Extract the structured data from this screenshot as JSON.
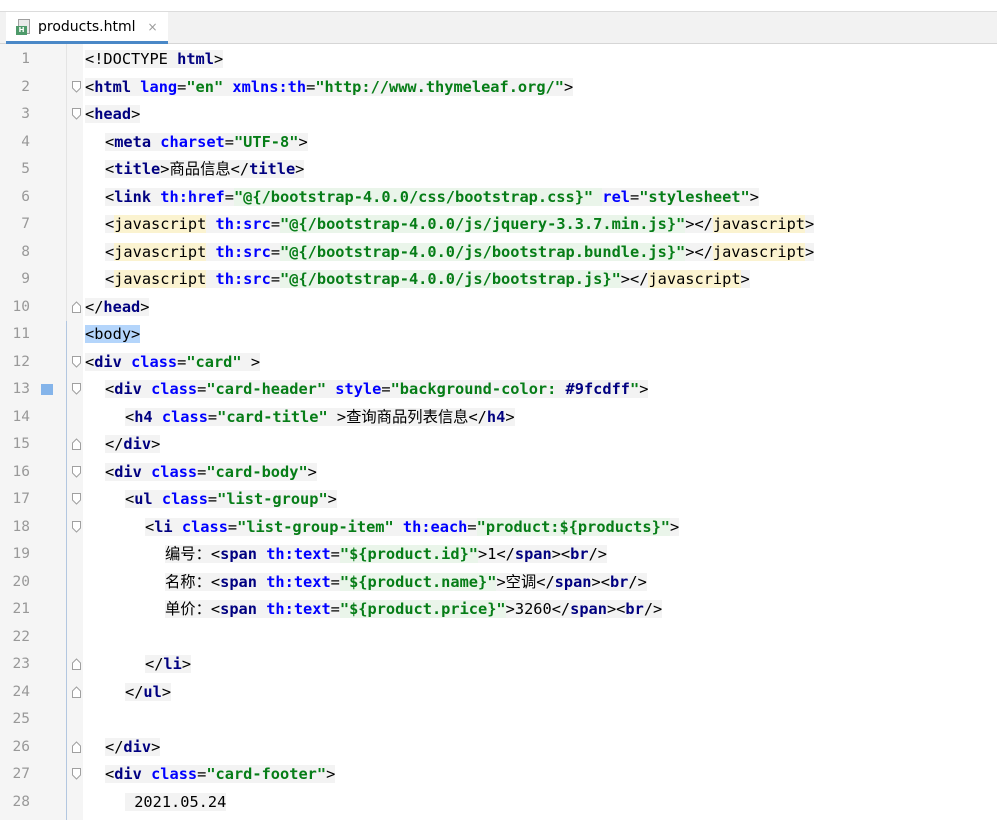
{
  "tab": {
    "file_name": "products.html",
    "icon_badge": "H",
    "close_glyph": "×"
  },
  "lines": [
    {
      "n": "1",
      "indent": 0,
      "fold": "",
      "parts": [
        [
          "tx",
          "<!DOCTYPE "
        ],
        [
          "tg",
          "html"
        ],
        [
          "tx",
          ">"
        ]
      ]
    },
    {
      "n": "2",
      "indent": 0,
      "fold": "open",
      "parts": [
        [
          "tx",
          "<"
        ],
        [
          "tg",
          "html "
        ],
        [
          "at",
          "lang"
        ],
        [
          "tx",
          "="
        ],
        [
          "av",
          "\"en\" "
        ],
        [
          "at",
          "xmlns:th"
        ],
        [
          "tx",
          "="
        ],
        [
          "av",
          "\"http://www.thymeleaf.org/\""
        ],
        [
          "tx",
          ">"
        ]
      ]
    },
    {
      "n": "3",
      "indent": 0,
      "fold": "open",
      "parts": [
        [
          "tx",
          "<"
        ],
        [
          "tg",
          "head"
        ],
        [
          "tx",
          ">"
        ]
      ]
    },
    {
      "n": "4",
      "indent": 1,
      "fold": "",
      "parts": [
        [
          "tx",
          "<"
        ],
        [
          "tg",
          "meta "
        ],
        [
          "at",
          "charset"
        ],
        [
          "tx",
          "="
        ],
        [
          "av",
          "\"UTF-8\""
        ],
        [
          "tx",
          ">"
        ]
      ]
    },
    {
      "n": "5",
      "indent": 1,
      "fold": "",
      "parts": [
        [
          "tx",
          "<"
        ],
        [
          "tg",
          "title"
        ],
        [
          "tx",
          ">商品信息</"
        ],
        [
          "tg",
          "title"
        ],
        [
          "tx",
          ">"
        ]
      ]
    },
    {
      "n": "6",
      "indent": 1,
      "fold": "",
      "parts": [
        [
          "tx",
          "<"
        ],
        [
          "tg",
          "link "
        ],
        [
          "at",
          "th:href"
        ],
        [
          "tx",
          "="
        ],
        [
          "ex",
          "\"@{/bootstrap-4.0.0/css/bootstrap.css}\" "
        ],
        [
          "at",
          "rel"
        ],
        [
          "tx",
          "="
        ],
        [
          "av",
          "\"stylesheet\""
        ],
        [
          "tx",
          ">"
        ]
      ]
    },
    {
      "n": "7",
      "indent": 1,
      "fold": "",
      "parts": [
        [
          "tx",
          "<"
        ],
        [
          "warn",
          "javascript"
        ],
        [
          "tx",
          " "
        ],
        [
          "at",
          "th:src"
        ],
        [
          "tx",
          "="
        ],
        [
          "ex",
          "\"@{/bootstrap-4.0.0/js/jquery-3.3.7.min.js}\""
        ],
        [
          "tx",
          "></"
        ],
        [
          "warn",
          "javascript"
        ],
        [
          "tx",
          ">"
        ]
      ]
    },
    {
      "n": "8",
      "indent": 1,
      "fold": "",
      "parts": [
        [
          "tx",
          "<"
        ],
        [
          "warn",
          "javascript"
        ],
        [
          "tx",
          " "
        ],
        [
          "at",
          "th:src"
        ],
        [
          "tx",
          "="
        ],
        [
          "ex",
          "\"@{/bootstrap-4.0.0/js/bootstrap.bundle.js}\""
        ],
        [
          "tx",
          "></"
        ],
        [
          "warn",
          "javascript"
        ],
        [
          "tx",
          ">"
        ]
      ]
    },
    {
      "n": "9",
      "indent": 1,
      "fold": "",
      "parts": [
        [
          "tx",
          "<"
        ],
        [
          "warn",
          "javascript"
        ],
        [
          "tx",
          " "
        ],
        [
          "at",
          "th:src"
        ],
        [
          "tx",
          "="
        ],
        [
          "ex",
          "\"@{/bootstrap-4.0.0/js/bootstrap.js}\""
        ],
        [
          "tx",
          "></"
        ],
        [
          "warn",
          "javascript"
        ],
        [
          "tx",
          ">"
        ]
      ]
    },
    {
      "n": "10",
      "indent": 0,
      "fold": "close",
      "parts": [
        [
          "tx",
          "</"
        ],
        [
          "tg",
          "head"
        ],
        [
          "tx",
          ">"
        ]
      ]
    },
    {
      "n": "11",
      "indent": 0,
      "fold": "",
      "parts": [
        [
          "hlbody",
          "<body>"
        ]
      ]
    },
    {
      "n": "12",
      "indent": 0,
      "fold": "open",
      "parts": [
        [
          "tx",
          "<"
        ],
        [
          "tg",
          "div "
        ],
        [
          "at",
          "class"
        ],
        [
          "tx",
          "="
        ],
        [
          "av",
          "\"card\" "
        ],
        [
          "tx",
          ">"
        ]
      ]
    },
    {
      "n": "13",
      "indent": 1,
      "fold": "open",
      "bookmark": true,
      "parts": [
        [
          "tx",
          "<"
        ],
        [
          "tg",
          "div "
        ],
        [
          "at",
          "class"
        ],
        [
          "tx",
          "="
        ],
        [
          "av",
          "\"card-header\" "
        ],
        [
          "at",
          "style"
        ],
        [
          "tx",
          "="
        ],
        [
          "av",
          "\"background-color: "
        ],
        [
          "tg",
          "#9fcdff"
        ],
        [
          "av",
          "\""
        ],
        [
          "tx",
          ">"
        ]
      ]
    },
    {
      "n": "14",
      "indent": 2,
      "fold": "",
      "parts": [
        [
          "tx",
          "<"
        ],
        [
          "tg",
          "h4 "
        ],
        [
          "at",
          "class"
        ],
        [
          "tx",
          "="
        ],
        [
          "av",
          "\"card-title\" "
        ],
        [
          "tx",
          ">查询商品列表信息</"
        ],
        [
          "tg",
          "h4"
        ],
        [
          "tx",
          ">"
        ]
      ]
    },
    {
      "n": "15",
      "indent": 1,
      "fold": "close",
      "parts": [
        [
          "tx",
          "</"
        ],
        [
          "tg",
          "div"
        ],
        [
          "tx",
          ">"
        ]
      ]
    },
    {
      "n": "16",
      "indent": 1,
      "fold": "open",
      "parts": [
        [
          "tx",
          "<"
        ],
        [
          "tg",
          "div "
        ],
        [
          "at",
          "class"
        ],
        [
          "tx",
          "="
        ],
        [
          "av",
          "\"card-body\""
        ],
        [
          "tx",
          ">"
        ]
      ]
    },
    {
      "n": "17",
      "indent": 2,
      "fold": "open",
      "parts": [
        [
          "tx",
          "<"
        ],
        [
          "tg",
          "ul "
        ],
        [
          "at",
          "class"
        ],
        [
          "tx",
          "="
        ],
        [
          "av",
          "\"list-group\""
        ],
        [
          "tx",
          ">"
        ]
      ]
    },
    {
      "n": "18",
      "indent": 3,
      "fold": "open",
      "parts": [
        [
          "tx",
          "<"
        ],
        [
          "tg",
          "li "
        ],
        [
          "at",
          "class"
        ],
        [
          "tx",
          "="
        ],
        [
          "av",
          "\"list-group-item\" "
        ],
        [
          "at",
          "th:each"
        ],
        [
          "tx",
          "="
        ],
        [
          "ex",
          "\"product:${products}\""
        ],
        [
          "tx",
          ">"
        ]
      ]
    },
    {
      "n": "19",
      "indent": 4,
      "fold": "",
      "parts": [
        [
          "tx",
          "编号："
        ],
        [
          "tx",
          "<"
        ],
        [
          "tg",
          "span "
        ],
        [
          "at",
          "th:text"
        ],
        [
          "tx",
          "="
        ],
        [
          "ex",
          "\"${product.id}\""
        ],
        [
          "tx",
          ">1</"
        ],
        [
          "tg",
          "span"
        ],
        [
          "tx",
          "><"
        ],
        [
          "tg",
          "br"
        ],
        [
          "tx",
          "/>"
        ]
      ]
    },
    {
      "n": "20",
      "indent": 4,
      "fold": "",
      "parts": [
        [
          "tx",
          "名称："
        ],
        [
          "tx",
          "<"
        ],
        [
          "tg",
          "span "
        ],
        [
          "at",
          "th:text"
        ],
        [
          "tx",
          "="
        ],
        [
          "ex",
          "\"${product.name}\""
        ],
        [
          "tx",
          ">空调</"
        ],
        [
          "tg",
          "span"
        ],
        [
          "tx",
          "><"
        ],
        [
          "tg",
          "br"
        ],
        [
          "tx",
          "/>"
        ]
      ]
    },
    {
      "n": "21",
      "indent": 4,
      "fold": "",
      "parts": [
        [
          "tx",
          "单价："
        ],
        [
          "tx",
          "<"
        ],
        [
          "tg",
          "span "
        ],
        [
          "at",
          "th:text"
        ],
        [
          "tx",
          "="
        ],
        [
          "ex",
          "\"${product.price}\""
        ],
        [
          "tx",
          ">3260</"
        ],
        [
          "tg",
          "span"
        ],
        [
          "tx",
          "><"
        ],
        [
          "tg",
          "br"
        ],
        [
          "tx",
          "/>"
        ]
      ]
    },
    {
      "n": "22",
      "indent": 0,
      "fold": "",
      "parts": []
    },
    {
      "n": "23",
      "indent": 3,
      "fold": "close",
      "parts": [
        [
          "tx",
          "</"
        ],
        [
          "tg",
          "li"
        ],
        [
          "tx",
          ">"
        ]
      ]
    },
    {
      "n": "24",
      "indent": 2,
      "fold": "close",
      "parts": [
        [
          "tx",
          "</"
        ],
        [
          "tg",
          "ul"
        ],
        [
          "tx",
          ">"
        ]
      ]
    },
    {
      "n": "25",
      "indent": 0,
      "fold": "",
      "parts": []
    },
    {
      "n": "26",
      "indent": 1,
      "fold": "close",
      "parts": [
        [
          "tx",
          "</"
        ],
        [
          "tg",
          "div"
        ],
        [
          "tx",
          ">"
        ]
      ]
    },
    {
      "n": "27",
      "indent": 1,
      "fold": "open",
      "parts": [
        [
          "tx",
          "<"
        ],
        [
          "tg",
          "div "
        ],
        [
          "at",
          "class"
        ],
        [
          "tx",
          "="
        ],
        [
          "av",
          "\"card-footer\""
        ],
        [
          "tx",
          ">"
        ]
      ]
    },
    {
      "n": "28",
      "indent": 2,
      "fold": "",
      "parts": [
        [
          "tx",
          " 2021.05.24"
        ]
      ]
    }
  ]
}
